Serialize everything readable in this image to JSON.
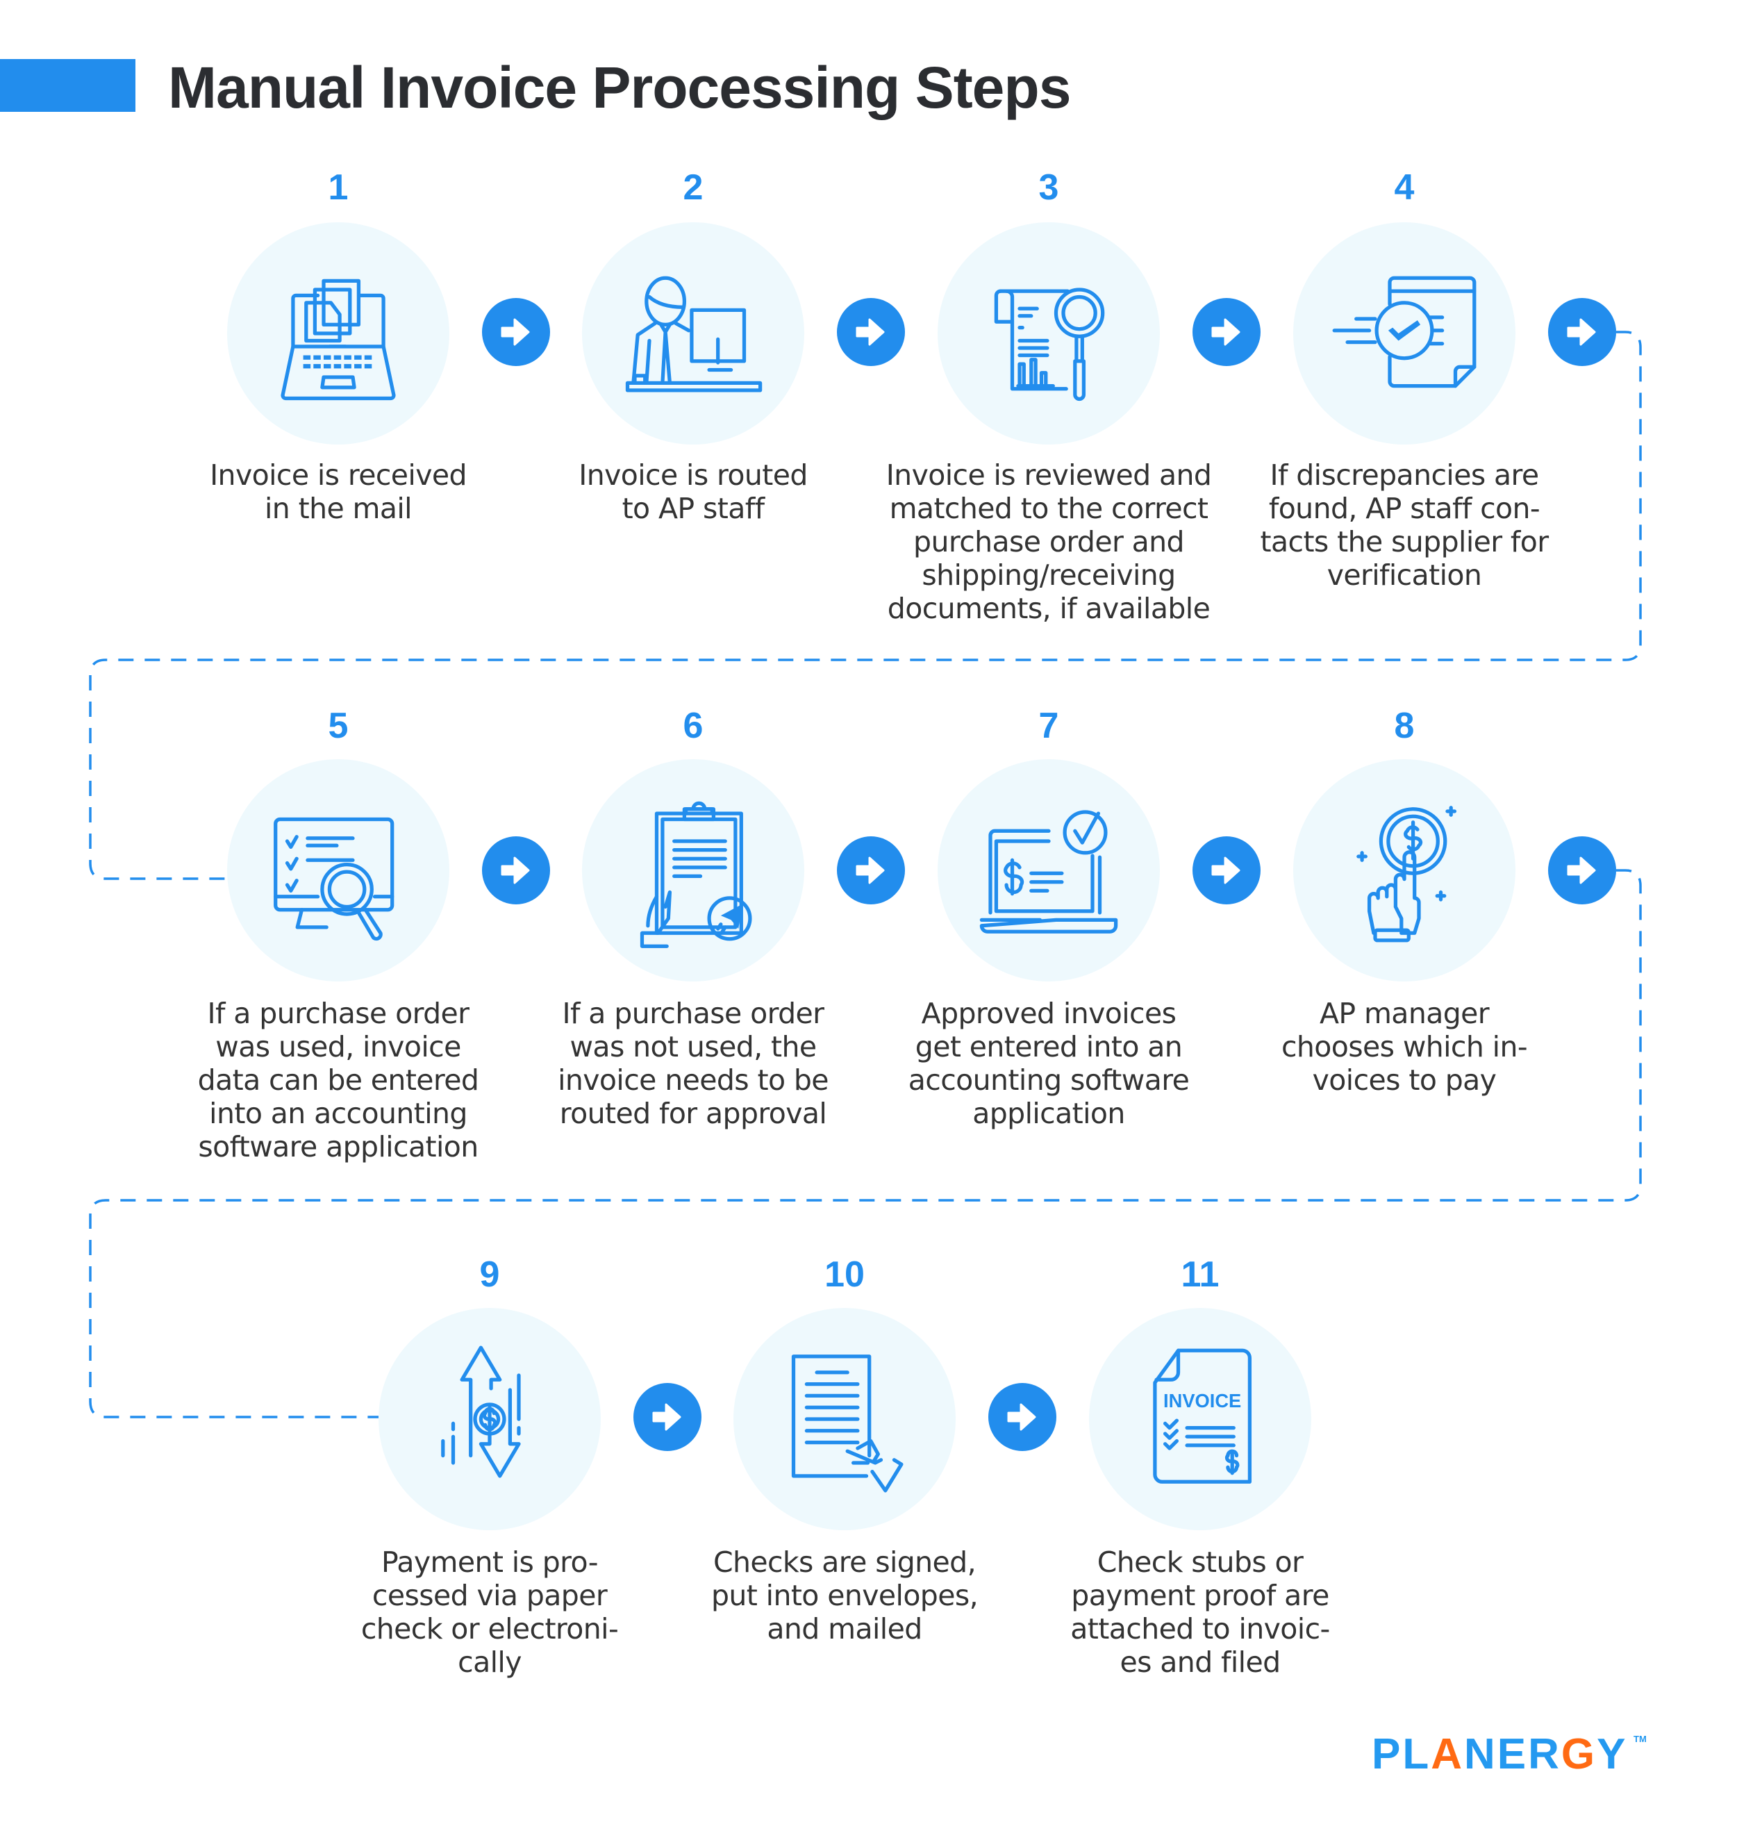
{
  "header": {
    "title": "Manual Invoice Processing Steps"
  },
  "colors": {
    "accent": "#228ded",
    "circle_bg": "#eef9fd",
    "text": "#333333",
    "title_text": "#2b2d31",
    "logo": "#2499f0",
    "logo_accent": "#ff6a13"
  },
  "steps": [
    {
      "number": "1",
      "icon": "laptop-documents-icon",
      "text": "Invoice is received\nin the mail"
    },
    {
      "number": "2",
      "icon": "staff-at-computer-icon",
      "text": "Invoice is routed\nto AP staff"
    },
    {
      "number": "3",
      "icon": "document-magnifier-icon",
      "text": "Invoice is reviewed and\nmatched to the correct\npurchase order and\nshipping/receiving\ndocuments, if available"
    },
    {
      "number": "4",
      "icon": "document-fast-check-icon",
      "text": "If discrepancies are\nfound, AP staff con-\ntacts the supplier for\nverification"
    },
    {
      "number": "5",
      "icon": "monitor-checklist-search-icon",
      "text": "If a purchase order\nwas used, invoice\ndata can be entered\ninto an accounting\nsoftware application"
    },
    {
      "number": "6",
      "icon": "clipboard-send-icon",
      "text": "If a purchase order\nwas not used, the\ninvoice needs to be\nrouted for approval"
    },
    {
      "number": "7",
      "icon": "laptop-dollar-check-icon",
      "text": "Approved invoices\nget entered into an\naccounting software\napplication"
    },
    {
      "number": "8",
      "icon": "hand-tap-coin-icon",
      "text": "AP manager\nchooses which in-\nvoices to pay"
    },
    {
      "number": "9",
      "icon": "dollar-exchange-arrows-icon",
      "text": "Payment is pro-\ncessed via paper\ncheck or electroni-\ncally"
    },
    {
      "number": "10",
      "icon": "document-signing-icon",
      "text": "Checks are signed,\nput into envelopes,\nand mailed"
    },
    {
      "number": "11",
      "icon": "invoice-document-icon",
      "text": "Check stubs or\npayment proof are\nattached to invoic-\nes and filed",
      "icon_label": "INVOICE"
    }
  ],
  "footer": {
    "logo_parts": [
      "PL",
      "A",
      "NER",
      "G",
      "Y"
    ],
    "trademark": "TM"
  }
}
